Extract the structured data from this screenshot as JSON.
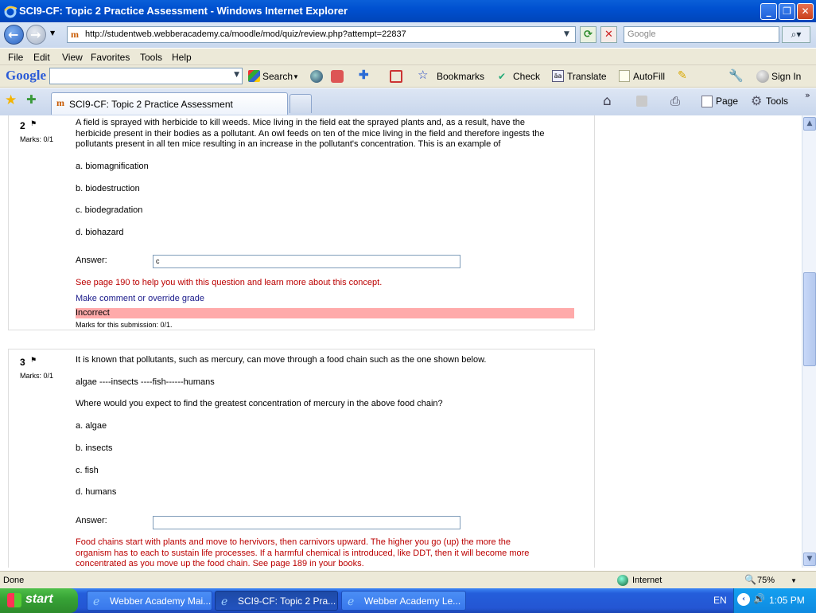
{
  "window": {
    "title": "SCI9-CF: Topic 2 Practice Assessment - Windows Internet Explorer",
    "minimize": "_",
    "restore": "❐",
    "close": "✕"
  },
  "address": {
    "url": "http://studentweb.webberacademy.ca/moodle/mod/quiz/review.php?attempt=22837",
    "search_placeholder": "Google"
  },
  "menu": [
    "File",
    "Edit",
    "View",
    "Favorites",
    "Tools",
    "Help"
  ],
  "google_toolbar": {
    "logo": "Google",
    "search": "Search",
    "bookmarks": "Bookmarks",
    "check": "Check",
    "translate": "Translate",
    "autofill": "AutoFill",
    "sign_in": "Sign In"
  },
  "tabs": {
    "active": "SCI9-CF: Topic 2 Practice Assessment",
    "page": "Page",
    "tools": "Tools"
  },
  "questions": [
    {
      "number": "2",
      "marks": "Marks: 0/1",
      "text_lines": [
        "A field is sprayed with herbicide to kill weeds. Mice living in the field eat the sprayed plants and, as a result, have the",
        "herbicide present in their bodies as a pollutant. An owl feeds on ten of the mice living in the field and therefore ingests the",
        "pollutants present in all ten mice resulting in an increase in the pollutant's concentration. This is an example of"
      ],
      "options": [
        "a. biomagnification",
        "b. biodestruction",
        "c. biodegradation",
        "d. biohazard"
      ],
      "answer_label": "Answer:",
      "answer_value": "c",
      "feedback": "See page 190 to help you with this question and learn more about this concept.",
      "comment_link": "Make comment or override grade",
      "result": "Incorrect",
      "submission_marks": "Marks for this submission: 0/1."
    },
    {
      "number": "3",
      "marks": "Marks: 0/1",
      "intro": "It is known that pollutants, such as mercury, can move through a food chain such as the one shown below.",
      "chain": "algae ----insects ----fish------humans",
      "question": "Where would you expect to find the greatest concentration of mercury in the above food chain?",
      "options": [
        "a. algae",
        "b. insects",
        "c. fish",
        "d. humans"
      ],
      "answer_label": "Answer:",
      "answer_value": "",
      "feedback_lines": [
        "Food chains start with plants and move to hervivors, then carnivors upward.  The higher you go (up) the more the",
        "organism has to each to sustain life processes.  If a harmful chemical is introduced, like DDT, then it will become more",
        "concentrated as you move up the food chain.  See page 189 in your books."
      ]
    }
  ],
  "status": {
    "text": "Done",
    "zone": "Internet",
    "zoom": "75%"
  },
  "taskbar": {
    "start": "start",
    "items": [
      "Webber Academy Mai...",
      "SCI9-CF: Topic 2 Pra...",
      "Webber Academy Le..."
    ],
    "lang": "EN",
    "clock": "1:05 PM"
  }
}
